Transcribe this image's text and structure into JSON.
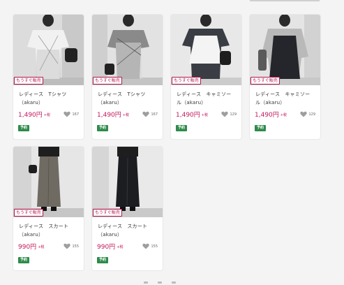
{
  "badge_label": "もうすぐ販売",
  "tax_label": "+税",
  "tag_label": "予約",
  "products": [
    {
      "title": "レディース　Tシャツ（akaru）",
      "price": "1,490円",
      "likes": "167"
    },
    {
      "title": "レディース　Tシャツ（akaru）",
      "price": "1,490円",
      "likes": "167"
    },
    {
      "title": "レディース　キャミソール（akaru）",
      "price": "1,490円",
      "likes": "129"
    },
    {
      "title": "レディース　キャミソール（akaru）",
      "price": "1,490円",
      "likes": "129"
    },
    {
      "title": "レディース　スカート（akaru）",
      "price": "990円",
      "likes": "155"
    },
    {
      "title": "レディース　スカート（akaru）",
      "price": "990円",
      "likes": "155"
    }
  ],
  "colors": {
    "price": "#c2185b",
    "badge": "#b5174a",
    "tag": "#2e8b4a"
  }
}
